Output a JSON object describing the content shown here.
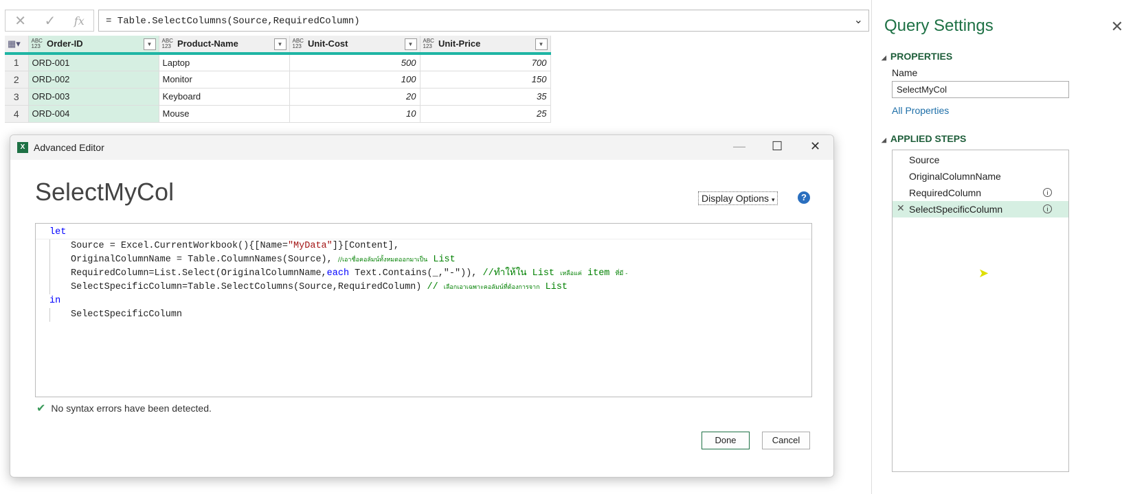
{
  "formula_bar": {
    "formula": "= Table.SelectColumns(Source,RequiredColumn)",
    "cancel": "✕",
    "confirm": "✓",
    "fx": "fx"
  },
  "grid": {
    "type_label_top": "ABC",
    "type_label_bottom": "123",
    "columns": [
      "Order-ID",
      "Product-Name",
      "Unit-Cost",
      "Unit-Price"
    ],
    "rows": [
      [
        "1",
        "ORD-001",
        "Laptop",
        "500",
        "700"
      ],
      [
        "2",
        "ORD-002",
        "Monitor",
        "100",
        "150"
      ],
      [
        "3",
        "ORD-003",
        "Keyboard",
        "20",
        "35"
      ],
      [
        "4",
        "ORD-004",
        "Mouse",
        "10",
        "25"
      ]
    ]
  },
  "query_settings": {
    "title": "Query Settings",
    "properties": "PROPERTIES",
    "name_label": "Name",
    "name_value": "SelectMyCol",
    "all_properties": "All Properties",
    "applied_steps": "APPLIED STEPS",
    "steps": [
      "Source",
      "OriginalColumnName",
      "RequiredColumn",
      "SelectSpecificColumn"
    ]
  },
  "editor": {
    "window_title": "Advanced Editor",
    "query_name": "SelectMyCol",
    "display_options": "Display Options",
    "help": "?",
    "code": {
      "let": "let",
      "l1a": "Source = Excel.CurrentWorkbook(){[Name=",
      "l1s": "\"MyData\"",
      "l1b": "]}[Content],",
      "l2": "OriginalColumnName = Table.ColumnNames(Source), ",
      "l2c": "//เอาชื่อคอลัมน์ทั้งหมดออกมาเป็น",
      "l2d": " List",
      "l3a": "RequiredColumn=List.Select(OriginalColumnName,",
      "l3k": "each",
      "l3b": " Text.Contains(_,\"-\")), ",
      "l3c1": "//ทำให้ใน List ",
      "l3t": "เหลือแค่",
      "l3c2": " item ",
      "l3t2": "ที่มี -",
      "l4": "SelectSpecificColumn=Table.SelectColumns(Source,RequiredColumn) ",
      "l4c": "// ",
      "l4t": "เลือกเอาเฉพาะคอลัมน์ที่ต้องการจาก",
      "l4d": " List",
      "in": "in",
      "l5": "SelectSpecificColumn"
    },
    "status": "No syntax errors have been detected.",
    "done": "Done",
    "cancel": "Cancel"
  }
}
